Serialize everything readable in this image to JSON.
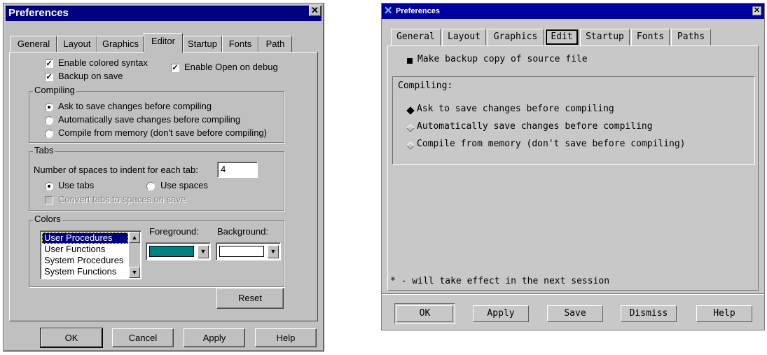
{
  "windows_dialog": {
    "title": "Preferences",
    "close_glyph": "✕",
    "tabs": [
      "General",
      "Layout",
      "Graphics",
      "Editor",
      "Startup",
      "Fonts",
      "Path"
    ],
    "active_tab": "Editor",
    "checkboxes": {
      "enable_colored_syntax": {
        "label": "Enable colored syntax",
        "checked": true
      },
      "backup_on_save": {
        "label": "Backup on save",
        "checked": true
      },
      "enable_open_on_debug": {
        "label": "Enable Open on debug",
        "checked": true
      }
    },
    "compiling": {
      "legend": "Compiling",
      "options": [
        "Ask to save changes before compiling",
        "Automatically save changes before compiling",
        "Compile from memory (don't save before compiling)"
      ],
      "selected": "Ask to save changes before compiling"
    },
    "tabs_group": {
      "legend": "Tabs",
      "indent_label": "Number of spaces to indent for each tab:",
      "indent_value": "4",
      "use_tabs_label": "Use tabs",
      "use_spaces_label": "Use spaces",
      "selected": "Use tabs",
      "convert_label": "Convert tabs to spaces on save",
      "convert_checked": false,
      "convert_enabled": false
    },
    "colors": {
      "legend": "Colors",
      "list_items": [
        "User Procedures",
        "User Functions",
        "System Procedures",
        "System Functions"
      ],
      "selected_item": "User Procedures",
      "foreground_label": "Foreground:",
      "background_label": "Background:",
      "foreground_color": "#008080",
      "background_color": "#ffffff"
    },
    "reset_label": "Reset",
    "buttons": [
      "OK",
      "Cancel",
      "Apply",
      "Help"
    ],
    "default_button": "OK"
  },
  "motif_dialog": {
    "title": "Preferences",
    "close_glyph": "✕",
    "tabs": [
      "General",
      "Layout",
      "Graphics",
      "Edit",
      "Startup",
      "Fonts",
      "Paths"
    ],
    "active_tab": "Edit",
    "backup_label": "Make backup copy of source file",
    "backup_checked": true,
    "compiling": {
      "legend": "Compiling:",
      "options": [
        "Ask to save changes before compiling",
        "Automatically save changes before compiling",
        "Compile from memory (don't save before compiling)"
      ],
      "selected": "Ask to save changes before compiling"
    },
    "footnote": "* - will take effect in the next session",
    "buttons": [
      "OK",
      "Apply",
      "Save",
      "Dismiss",
      "Help"
    ],
    "accent_color": "#0000a0"
  }
}
